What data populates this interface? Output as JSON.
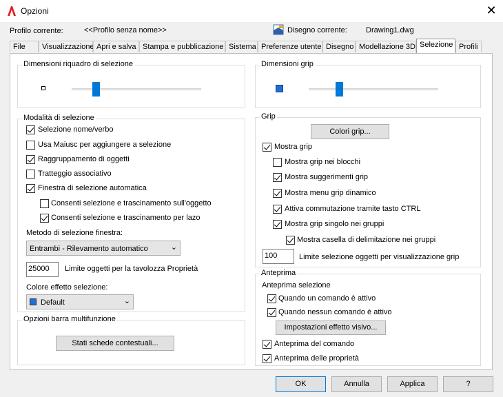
{
  "window": {
    "title": "Opzioni",
    "close_icon": "✕"
  },
  "profile": {
    "current_label": "Profilo corrente:",
    "current_value": "<<Profilo senza nome>>",
    "drawing_label": "Disegno corrente:",
    "drawing_value": "Drawing1.dwg"
  },
  "tabs": [
    "File",
    "Visualizzazione",
    "Apri e salva",
    "Stampa e pubblicazione",
    "Sistema",
    "Preferenze utente",
    "Disegno",
    "Modellazione 3D",
    "Selezione",
    "Profili"
  ],
  "active_tab": "Selezione",
  "pickbox": {
    "title": "Dimensioni riquadro di selezione",
    "level": 0.17
  },
  "selection_modes": {
    "title": "Modalità di selezione",
    "items": [
      {
        "label": "Selezione nome/verbo",
        "checked": true
      },
      {
        "label": "Usa Maiusc per aggiungere a selezione",
        "checked": false
      },
      {
        "label": "Raggruppamento di oggetti",
        "checked": true
      },
      {
        "label": "Tratteggio associativo",
        "checked": false
      },
      {
        "label": "Finestra di selezione automatica",
        "checked": true
      },
      {
        "label": "Consenti selezione e trascinamento sull'oggetto",
        "checked": false
      },
      {
        "label": "Consenti selezione e trascinamento per lazo",
        "checked": true
      }
    ],
    "window_method_label": "Metodo di selezione finestra:",
    "window_method_value": "Entrambi - Rilevamento automatico",
    "limit_value": "25000",
    "limit_label": "Limite oggetti per la tavolozza Proprietà",
    "effect_color_label": "Colore effetto selezione:",
    "effect_color_value": "Default",
    "effect_color_swatch": "#1e6fd6"
  },
  "ribbon": {
    "title": "Opzioni barra multifunzione",
    "button": "Stati schede contestuali..."
  },
  "grip_size": {
    "title": "Dimensioni grip",
    "level": 0.22
  },
  "grips": {
    "title": "Grip",
    "colors_button": "Colori grip...",
    "items": [
      {
        "label": "Mostra grip",
        "checked": true
      },
      {
        "label": "Mostra grip nei blocchi",
        "checked": false
      },
      {
        "label": "Mostra suggerimenti grip",
        "checked": true
      },
      {
        "label": "Mostra menu grip dinamico",
        "checked": true
      },
      {
        "label": "Attiva commutazione tramite tasto CTRL",
        "checked": true
      },
      {
        "label": "Mostra grip singolo nei gruppi",
        "checked": true
      },
      {
        "label": "Mostra casella di delimitazione nei gruppi",
        "checked": true
      }
    ],
    "limit_value": "100",
    "limit_label": "Limite selezione oggetti per visualizzazione grip"
  },
  "preview": {
    "title": "Anteprima",
    "subtitle": "Anteprima selezione",
    "items": [
      {
        "label": "Quando un comando è attivo",
        "checked": true
      },
      {
        "label": "Quando nessun comando è attivo",
        "checked": true
      }
    ],
    "effect_button": "Impostazioni effetto visivo...",
    "extra": [
      {
        "label": "Anteprima del comando",
        "checked": true
      },
      {
        "label": "Anteprima delle proprietà",
        "checked": true
      }
    ]
  },
  "footer": {
    "ok": "OK",
    "cancel": "Annulla",
    "apply": "Applica",
    "help": "?"
  }
}
